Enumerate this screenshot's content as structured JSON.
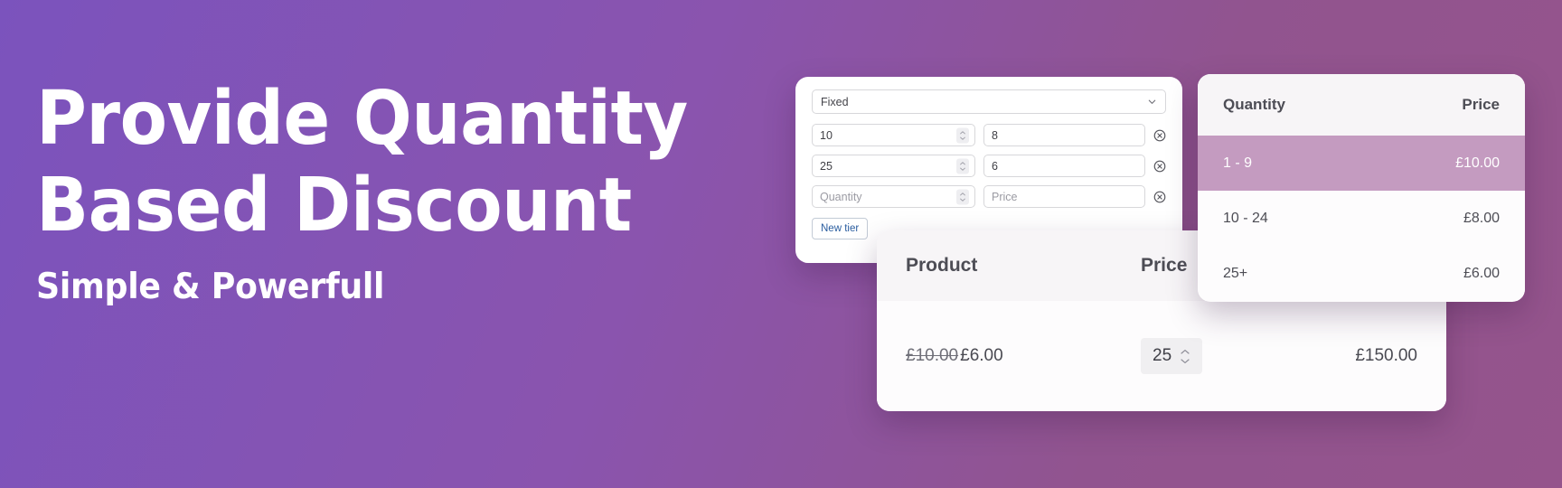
{
  "theme": {
    "gradient_start": "#7b53bd",
    "gradient_end": "#95548c",
    "highlight_row": "#c49bc0",
    "link_blue": "#2a5d9f"
  },
  "hero": {
    "headline_line_1": "Provide Quantity",
    "headline_line_2": "Based Discount",
    "subtitle": "Simple & Powerfull"
  },
  "tier_panel": {
    "discount_type": {
      "selected": "Fixed",
      "icon": "chevron-down-icon"
    },
    "rows": [
      {
        "quantity": "10",
        "price": "8",
        "remove_icon": "remove-circle-icon"
      },
      {
        "quantity": "25",
        "price": "6",
        "remove_icon": "remove-circle-icon"
      }
    ],
    "new_row": {
      "quantity_placeholder": "Quantity",
      "price_placeholder": "Price",
      "remove_icon": "remove-circle-icon"
    },
    "new_tier_label": "New tier"
  },
  "pricing_table": {
    "headers": {
      "quantity": "Quantity",
      "price": "Price"
    },
    "rows": [
      {
        "quantity": "1 - 9",
        "price": "£10.00",
        "highlighted": true
      },
      {
        "quantity": "10 - 24",
        "price": "£8.00",
        "highlighted": false
      },
      {
        "quantity": "25+",
        "price": "£6.00",
        "highlighted": false
      }
    ]
  },
  "cart_panel": {
    "headers": {
      "product": "Product",
      "price": "Price"
    },
    "row": {
      "price_original": "£10.00",
      "price_discounted": "£6.00",
      "quantity": "25",
      "line_total": "£150.00"
    }
  }
}
